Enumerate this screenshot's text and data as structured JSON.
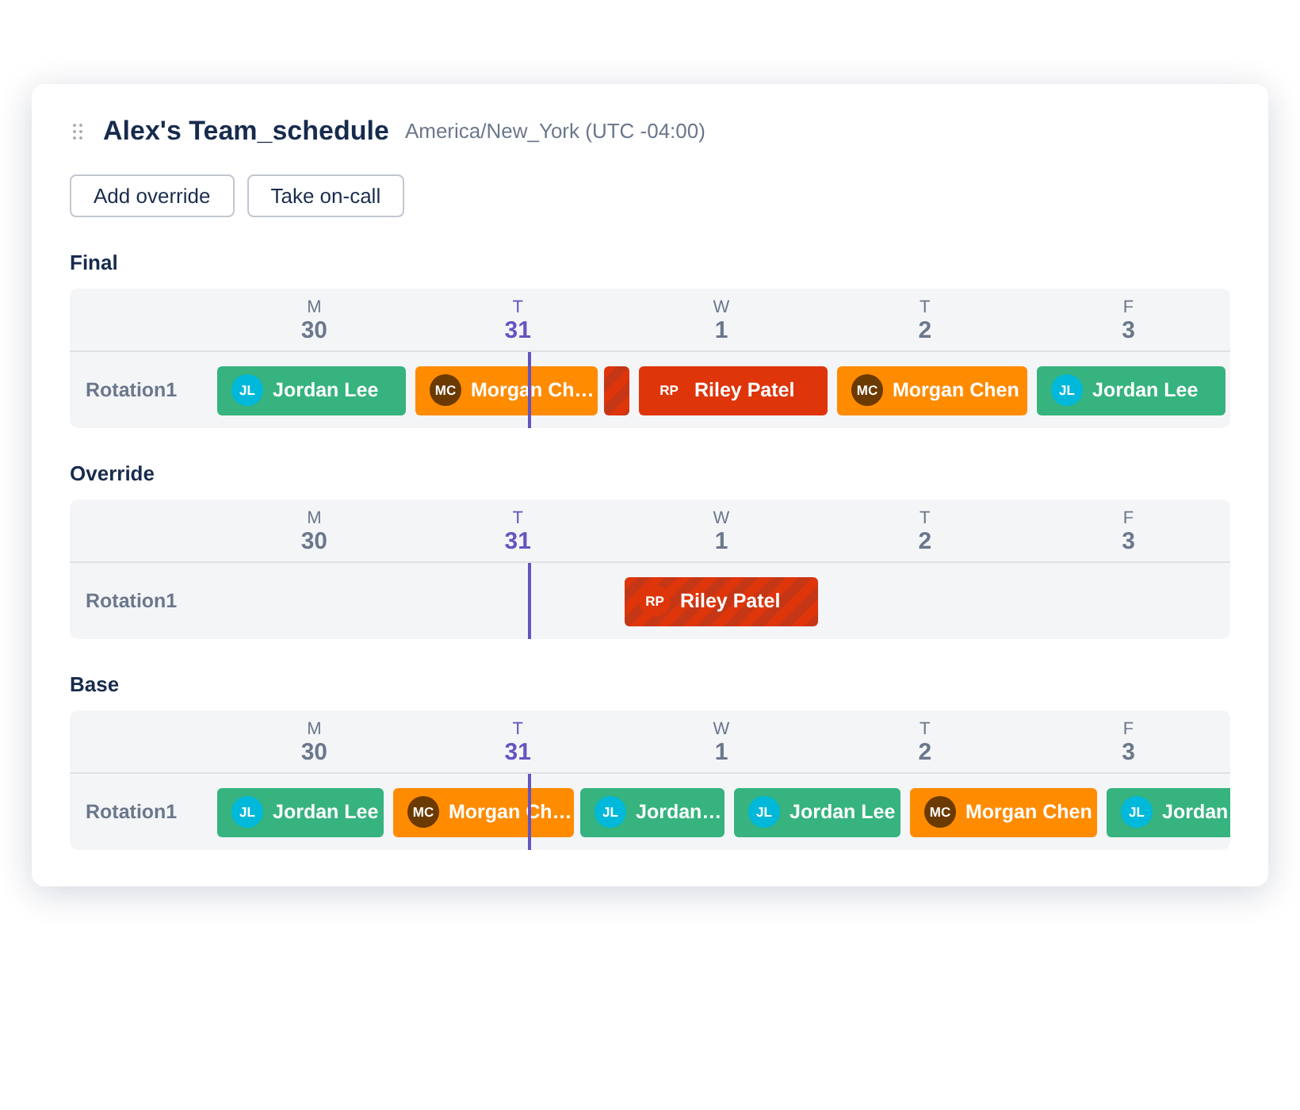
{
  "header": {
    "title": "Alex's Team_schedule",
    "timezone": "America/New_York (UTC -04:00)"
  },
  "actions": [
    {
      "label": "Add override"
    },
    {
      "label": "Take on-call"
    }
  ],
  "sections": [
    {
      "title": "Final",
      "days": [
        {
          "weekday": "M",
          "date": "30",
          "today": false
        },
        {
          "weekday": "T",
          "date": "31",
          "today": true
        },
        {
          "weekday": "W",
          "date": "1",
          "today": false
        },
        {
          "weekday": "T",
          "date": "2",
          "today": false
        },
        {
          "weekday": "F",
          "date": "3",
          "today": false
        }
      ],
      "rows": [
        {
          "label": "Rotation1",
          "shifts": [
            {
              "avatar": {
                "initials": "JL",
                "color": "#00b8d9"
              },
              "name": "Jordan Lee",
              "color": "#36b37e",
              "striped": false
            },
            {
              "avatar": {
                "initials": "MC",
                "color": "#6b3a00"
              },
              "name": "Morgan Ch…",
              "color": "#ff8b00",
              "striped": false
            },
            {
              "color": "#de350b",
              "striped": true
            },
            {
              "avatar": {
                "initials": "RP",
                "color": "#de350b"
              },
              "name": "Riley Patel",
              "color": "#de350b",
              "striped": false
            },
            {
              "avatar": {
                "initials": "MC",
                "color": "#6b3a00"
              },
              "name": "Morgan Chen",
              "color": "#ff8b00",
              "striped": false
            },
            {
              "avatar": {
                "initials": "JL",
                "color": "#00b8d9"
              },
              "name": "Jordan Lee",
              "color": "#36b37e",
              "striped": false
            }
          ]
        }
      ]
    },
    {
      "title": "Override",
      "days": [
        {
          "weekday": "M",
          "date": "30",
          "today": false
        },
        {
          "weekday": "T",
          "date": "31",
          "today": true
        },
        {
          "weekday": "W",
          "date": "1",
          "today": false
        },
        {
          "weekday": "T",
          "date": "2",
          "today": false
        },
        {
          "weekday": "F",
          "date": "3",
          "today": false
        }
      ],
      "rows": [
        {
          "label": "Rotation1",
          "shifts": [
            {
              "avatar": {
                "initials": "RP",
                "color": "#de350b"
              },
              "name": "Riley Patel",
              "color": "#de350b",
              "striped": true
            }
          ]
        }
      ]
    },
    {
      "title": "Base",
      "days": [
        {
          "weekday": "M",
          "date": "30",
          "today": false
        },
        {
          "weekday": "T",
          "date": "31",
          "today": true
        },
        {
          "weekday": "W",
          "date": "1",
          "today": false
        },
        {
          "weekday": "T",
          "date": "2",
          "today": false
        },
        {
          "weekday": "F",
          "date": "3",
          "today": false
        }
      ],
      "rows": [
        {
          "label": "Rotation1",
          "shifts": [
            {
              "avatar": {
                "initials": "JL",
                "color": "#00b8d9"
              },
              "name": "Jordan Lee",
              "color": "#36b37e",
              "striped": false
            },
            {
              "avatar": {
                "initials": "MC",
                "color": "#6b3a00"
              },
              "name": "Morgan Ch…",
              "color": "#ff8b00",
              "striped": false
            },
            {
              "avatar": {
                "initials": "JL",
                "color": "#00b8d9"
              },
              "name": "Jordan…",
              "color": "#36b37e",
              "striped": false
            },
            {
              "avatar": {
                "initials": "JL",
                "color": "#00b8d9"
              },
              "name": "Jordan Lee",
              "color": "#36b37e",
              "striped": false
            },
            {
              "avatar": {
                "initials": "MC",
                "color": "#6b3a00"
              },
              "name": "Morgan Chen",
              "color": "#ff8b00",
              "striped": false
            },
            {
              "avatar": {
                "initials": "JL",
                "color": "#00b8d9"
              },
              "name": "Jordan",
              "color": "#36b37e",
              "striped": false
            }
          ]
        }
      ]
    }
  ]
}
